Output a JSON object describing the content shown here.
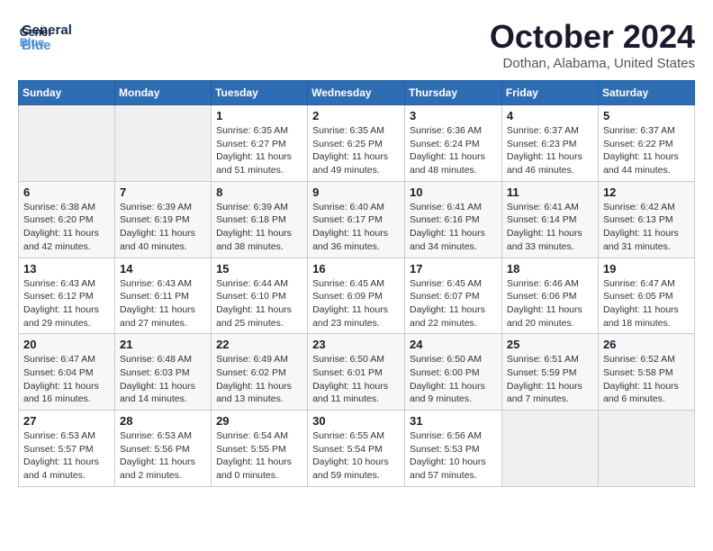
{
  "header": {
    "logo_general": "General",
    "logo_blue": "Blue",
    "month": "October 2024",
    "location": "Dothan, Alabama, United States"
  },
  "calendar": {
    "days_of_week": [
      "Sunday",
      "Monday",
      "Tuesday",
      "Wednesday",
      "Thursday",
      "Friday",
      "Saturday"
    ],
    "weeks": [
      [
        {
          "day": "",
          "info": ""
        },
        {
          "day": "",
          "info": ""
        },
        {
          "day": "1",
          "info": "Sunrise: 6:35 AM\nSunset: 6:27 PM\nDaylight: 11 hours\nand 51 minutes."
        },
        {
          "day": "2",
          "info": "Sunrise: 6:35 AM\nSunset: 6:25 PM\nDaylight: 11 hours\nand 49 minutes."
        },
        {
          "day": "3",
          "info": "Sunrise: 6:36 AM\nSunset: 6:24 PM\nDaylight: 11 hours\nand 48 minutes."
        },
        {
          "day": "4",
          "info": "Sunrise: 6:37 AM\nSunset: 6:23 PM\nDaylight: 11 hours\nand 46 minutes."
        },
        {
          "day": "5",
          "info": "Sunrise: 6:37 AM\nSunset: 6:22 PM\nDaylight: 11 hours\nand 44 minutes."
        }
      ],
      [
        {
          "day": "6",
          "info": "Sunrise: 6:38 AM\nSunset: 6:20 PM\nDaylight: 11 hours\nand 42 minutes."
        },
        {
          "day": "7",
          "info": "Sunrise: 6:39 AM\nSunset: 6:19 PM\nDaylight: 11 hours\nand 40 minutes."
        },
        {
          "day": "8",
          "info": "Sunrise: 6:39 AM\nSunset: 6:18 PM\nDaylight: 11 hours\nand 38 minutes."
        },
        {
          "day": "9",
          "info": "Sunrise: 6:40 AM\nSunset: 6:17 PM\nDaylight: 11 hours\nand 36 minutes."
        },
        {
          "day": "10",
          "info": "Sunrise: 6:41 AM\nSunset: 6:16 PM\nDaylight: 11 hours\nand 34 minutes."
        },
        {
          "day": "11",
          "info": "Sunrise: 6:41 AM\nSunset: 6:14 PM\nDaylight: 11 hours\nand 33 minutes."
        },
        {
          "day": "12",
          "info": "Sunrise: 6:42 AM\nSunset: 6:13 PM\nDaylight: 11 hours\nand 31 minutes."
        }
      ],
      [
        {
          "day": "13",
          "info": "Sunrise: 6:43 AM\nSunset: 6:12 PM\nDaylight: 11 hours\nand 29 minutes."
        },
        {
          "day": "14",
          "info": "Sunrise: 6:43 AM\nSunset: 6:11 PM\nDaylight: 11 hours\nand 27 minutes."
        },
        {
          "day": "15",
          "info": "Sunrise: 6:44 AM\nSunset: 6:10 PM\nDaylight: 11 hours\nand 25 minutes."
        },
        {
          "day": "16",
          "info": "Sunrise: 6:45 AM\nSunset: 6:09 PM\nDaylight: 11 hours\nand 23 minutes."
        },
        {
          "day": "17",
          "info": "Sunrise: 6:45 AM\nSunset: 6:07 PM\nDaylight: 11 hours\nand 22 minutes."
        },
        {
          "day": "18",
          "info": "Sunrise: 6:46 AM\nSunset: 6:06 PM\nDaylight: 11 hours\nand 20 minutes."
        },
        {
          "day": "19",
          "info": "Sunrise: 6:47 AM\nSunset: 6:05 PM\nDaylight: 11 hours\nand 18 minutes."
        }
      ],
      [
        {
          "day": "20",
          "info": "Sunrise: 6:47 AM\nSunset: 6:04 PM\nDaylight: 11 hours\nand 16 minutes."
        },
        {
          "day": "21",
          "info": "Sunrise: 6:48 AM\nSunset: 6:03 PM\nDaylight: 11 hours\nand 14 minutes."
        },
        {
          "day": "22",
          "info": "Sunrise: 6:49 AM\nSunset: 6:02 PM\nDaylight: 11 hours\nand 13 minutes."
        },
        {
          "day": "23",
          "info": "Sunrise: 6:50 AM\nSunset: 6:01 PM\nDaylight: 11 hours\nand 11 minutes."
        },
        {
          "day": "24",
          "info": "Sunrise: 6:50 AM\nSunset: 6:00 PM\nDaylight: 11 hours\nand 9 minutes."
        },
        {
          "day": "25",
          "info": "Sunrise: 6:51 AM\nSunset: 5:59 PM\nDaylight: 11 hours\nand 7 minutes."
        },
        {
          "day": "26",
          "info": "Sunrise: 6:52 AM\nSunset: 5:58 PM\nDaylight: 11 hours\nand 6 minutes."
        }
      ],
      [
        {
          "day": "27",
          "info": "Sunrise: 6:53 AM\nSunset: 5:57 PM\nDaylight: 11 hours\nand 4 minutes."
        },
        {
          "day": "28",
          "info": "Sunrise: 6:53 AM\nSunset: 5:56 PM\nDaylight: 11 hours\nand 2 minutes."
        },
        {
          "day": "29",
          "info": "Sunrise: 6:54 AM\nSunset: 5:55 PM\nDaylight: 11 hours\nand 0 minutes."
        },
        {
          "day": "30",
          "info": "Sunrise: 6:55 AM\nSunset: 5:54 PM\nDaylight: 10 hours\nand 59 minutes."
        },
        {
          "day": "31",
          "info": "Sunrise: 6:56 AM\nSunset: 5:53 PM\nDaylight: 10 hours\nand 57 minutes."
        },
        {
          "day": "",
          "info": ""
        },
        {
          "day": "",
          "info": ""
        }
      ]
    ]
  }
}
